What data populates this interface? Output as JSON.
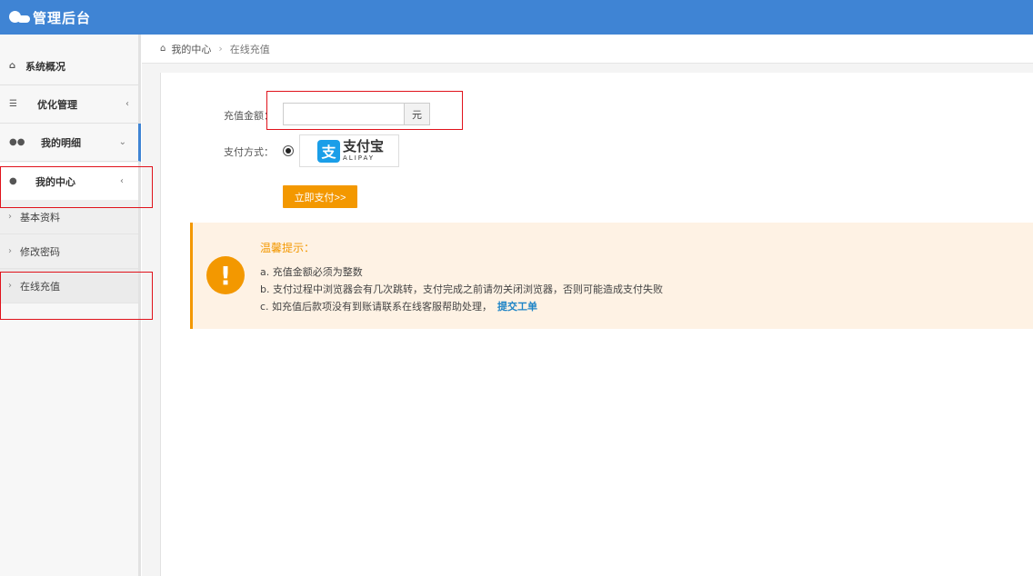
{
  "header": {
    "brand": "管理后台"
  },
  "sidebar": {
    "items": [
      {
        "label": "系统概况",
        "icon": "home-icon",
        "has_arrow": false
      },
      {
        "label": "优化管理",
        "icon": "list-icon",
        "arrow": "‹"
      },
      {
        "label": "我的明细",
        "icon": "users-icon",
        "arrow": "⌄"
      },
      {
        "label": "我的中心",
        "icon": "user-icon",
        "arrow": "‹"
      }
    ],
    "sub_items": [
      {
        "label": "基本资料"
      },
      {
        "label": "修改密码"
      },
      {
        "label": "在线充值"
      }
    ]
  },
  "breadcrumb": {
    "parent": "我的中心",
    "current": "在线充值"
  },
  "form": {
    "amount_label": "充值金额：",
    "amount_value": "",
    "amount_unit": "元",
    "method_label": "支付方式：",
    "alipay_cn": "支付宝",
    "alipay_en": "ALIPAY",
    "alipay_mark": "支",
    "submit_label": "立即支付>>"
  },
  "notice": {
    "title": "温馨提示：",
    "icon_glyph": "!",
    "lines": [
      "a. 充值金额必须为整数",
      "b. 支付过程中浏览器会有几次跳转，支付完成之前请勿关闭浏览器，否则可能造成支付失败",
      "c. 如充值后款项没有到账请联系在线客服帮助处理，"
    ],
    "link_label": "提交工单"
  },
  "colors": {
    "header": "#3f84d4",
    "accent_orange": "#f39800",
    "notice_bg": "#fef2e4",
    "highlight_red": "#e0121b",
    "link_blue": "#1d84c6"
  }
}
